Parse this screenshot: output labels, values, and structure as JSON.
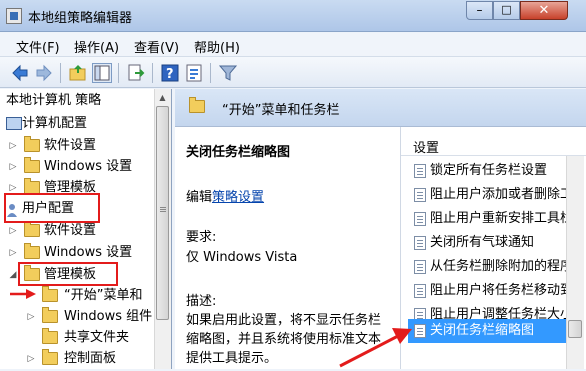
{
  "window": {
    "title": "本地组策略编辑器",
    "minimize": "–",
    "maximize": "□",
    "close": "✕"
  },
  "menu": [
    "文件(F)",
    "操作(A)",
    "查看(V)",
    "帮助(H)"
  ],
  "toolbar_icons": [
    "back-icon",
    "forward-icon",
    "up-folder-icon",
    "show-hide-tree-icon",
    "export-list-icon",
    "help-icon",
    "properties-icon",
    "filter-icon"
  ],
  "tree": {
    "root": "本地计算机 策略",
    "computer_config": "计算机配置",
    "computer_children": [
      "软件设置",
      "Windows 设置",
      "管理模板"
    ],
    "user_config": "用户配置",
    "user_children": [
      "软件设置",
      "Windows 设置",
      "管理模板"
    ],
    "admin_children": [
      "“开始”菜单和",
      "Windows 组件",
      "共享文件夹",
      "控制面板"
    ]
  },
  "right_header": "“开始”菜单和任务栏",
  "description": {
    "title": "关闭任务栏缩略图",
    "edit_prefix": "编辑",
    "edit_link": "策略设置",
    "requirements_label": "要求:",
    "requirements_value": "仅 Windows Vista",
    "desc_label": "描述:",
    "desc_lines": [
      "如果启用此设置，将不显示任务栏",
      "缩略图，并且系统将使用标准文本",
      "提供工具提示。"
    ]
  },
  "list": {
    "header": "设置",
    "items": [
      "锁定所有任务栏设置",
      "阻止用户添加或者删除工",
      "阻止用户重新安排工具栏",
      "关闭所有气球通知",
      "从任务栏删除附加的程序",
      "阻止用户将任务栏移动到",
      "阻止用户调整任务栏大小",
      "关闭任务栏缩略图"
    ],
    "selected_index": 7
  },
  "colors": {
    "accent": "#3399ff",
    "annotation": "#e31b1b"
  }
}
